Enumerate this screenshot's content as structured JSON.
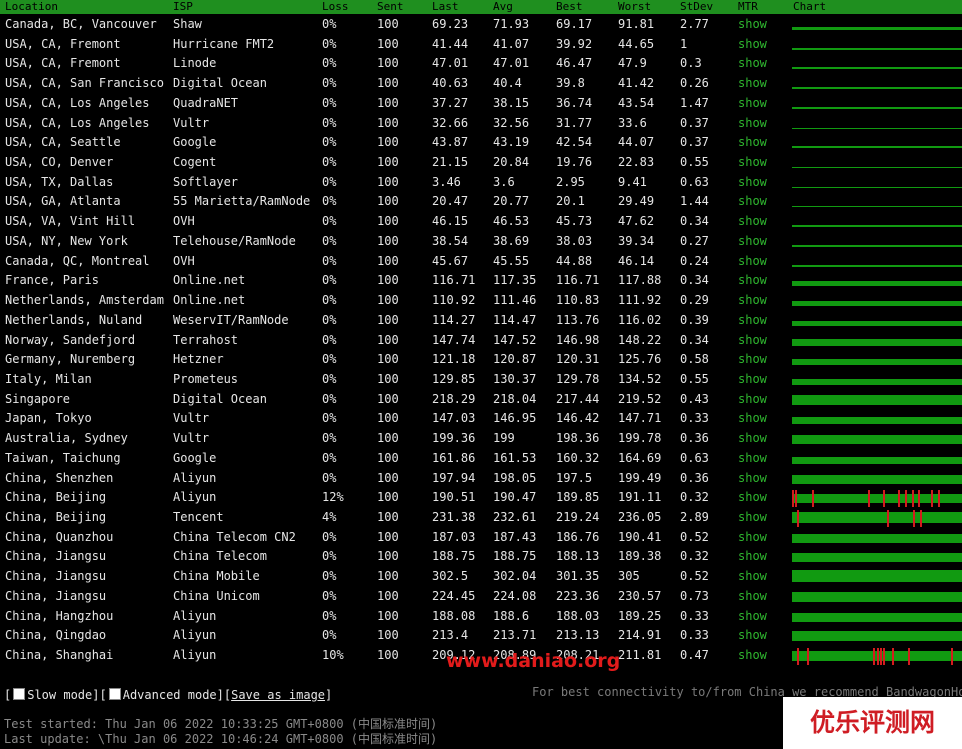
{
  "colors": {
    "header_bg": "#1f8f1f",
    "chart_green": "#119a11",
    "loss_red": "#d41d1d",
    "mtr_link": "#2fb72f"
  },
  "headers": {
    "location": "Location",
    "isp": "ISP",
    "loss": "Loss",
    "sent": "Sent",
    "last": "Last",
    "avg": "Avg",
    "best": "Best",
    "worst": "Worst",
    "stdev": "StDev",
    "mtr": "MTR",
    "chart": "Chart"
  },
  "rows": [
    {
      "location": "Canada, BC, Vancouver",
      "isp": "Shaw",
      "loss": "0%",
      "sent": "100",
      "last": "69.23",
      "avg": "71.93",
      "best": "69.17",
      "worst": "91.81",
      "stdev": "2.77",
      "mtr": "show",
      "chart_fill": 0.28,
      "chart_spikes": []
    },
    {
      "location": "USA, CA, Fremont",
      "isp": "Hurricane FMT2",
      "loss": "0%",
      "sent": "100",
      "last": "41.44",
      "avg": "41.07",
      "best": "39.92",
      "worst": "44.65",
      "stdev": "1",
      "mtr": "show",
      "chart_fill": 0.16,
      "chart_spikes": []
    },
    {
      "location": "USA, CA, Fremont",
      "isp": "Linode",
      "loss": "0%",
      "sent": "100",
      "last": "47.01",
      "avg": "47.01",
      "best": "46.47",
      "worst": "47.9",
      "stdev": "0.3",
      "mtr": "show",
      "chart_fill": 0.18,
      "chart_spikes": []
    },
    {
      "location": "USA, CA, San Francisco",
      "isp": "Digital Ocean",
      "loss": "0%",
      "sent": "100",
      "last": "40.63",
      "avg": "40.4",
      "best": "39.8",
      "worst": "41.42",
      "stdev": "0.26",
      "mtr": "show",
      "chart_fill": 0.15,
      "chart_spikes": []
    },
    {
      "location": "USA, CA, Los Angeles",
      "isp": "QuadraNET",
      "loss": "0%",
      "sent": "100",
      "last": "37.27",
      "avg": "38.15",
      "best": "36.74",
      "worst": "43.54",
      "stdev": "1.47",
      "mtr": "show",
      "chart_fill": 0.15,
      "chart_spikes": []
    },
    {
      "location": "USA, CA, Los Angeles",
      "isp": "Vultr",
      "loss": "0%",
      "sent": "100",
      "last": "32.66",
      "avg": "32.56",
      "best": "31.77",
      "worst": "33.6",
      "stdev": "0.37",
      "mtr": "show",
      "chart_fill": 0.12,
      "chart_spikes": []
    },
    {
      "location": "USA, CA, Seattle",
      "isp": "Google",
      "loss": "0%",
      "sent": "100",
      "last": "43.87",
      "avg": "43.19",
      "best": "42.54",
      "worst": "44.07",
      "stdev": "0.37",
      "mtr": "show",
      "chart_fill": 0.17,
      "chart_spikes": []
    },
    {
      "location": "USA, CO, Denver",
      "isp": "Cogent",
      "loss": "0%",
      "sent": "100",
      "last": "21.15",
      "avg": "20.84",
      "best": "19.76",
      "worst": "22.83",
      "stdev": "0.55",
      "mtr": "show",
      "chart_fill": 0.08,
      "chart_spikes": []
    },
    {
      "location": "USA, TX, Dallas",
      "isp": "Softlayer",
      "loss": "0%",
      "sent": "100",
      "last": "3.46",
      "avg": "3.6",
      "best": "2.95",
      "worst": "9.41",
      "stdev": "0.63",
      "mtr": "show",
      "chart_fill": 0.05,
      "chart_spikes": []
    },
    {
      "location": "USA, GA, Atlanta",
      "isp": "55 Marietta/RamNode",
      "loss": "0%",
      "sent": "100",
      "last": "20.47",
      "avg": "20.77",
      "best": "20.1",
      "worst": "29.49",
      "stdev": "1.44",
      "mtr": "show",
      "chart_fill": 0.08,
      "chart_spikes": []
    },
    {
      "location": "USA, VA, Vint Hill",
      "isp": "OVH",
      "loss": "0%",
      "sent": "100",
      "last": "46.15",
      "avg": "46.53",
      "best": "45.73",
      "worst": "47.62",
      "stdev": "0.34",
      "mtr": "show",
      "chart_fill": 0.18,
      "chart_spikes": []
    },
    {
      "location": "USA, NY, New York",
      "isp": "Telehouse/RamNode",
      "loss": "0%",
      "sent": "100",
      "last": "38.54",
      "avg": "38.69",
      "best": "38.03",
      "worst": "39.34",
      "stdev": "0.27",
      "mtr": "show",
      "chart_fill": 0.15,
      "chart_spikes": []
    },
    {
      "location": "Canada, QC, Montreal",
      "isp": "OVH",
      "loss": "0%",
      "sent": "100",
      "last": "45.67",
      "avg": "45.55",
      "best": "44.88",
      "worst": "46.14",
      "stdev": "0.24",
      "mtr": "show",
      "chart_fill": 0.17,
      "chart_spikes": []
    },
    {
      "location": "France, Paris",
      "isp": "Online.net",
      "loss": "0%",
      "sent": "100",
      "last": "116.71",
      "avg": "117.35",
      "best": "116.71",
      "worst": "117.88",
      "stdev": "0.34",
      "mtr": "show",
      "chart_fill": 0.45,
      "chart_spikes": []
    },
    {
      "location": "Netherlands, Amsterdam",
      "isp": "Online.net",
      "loss": "0%",
      "sent": "100",
      "last": "110.92",
      "avg": "111.46",
      "best": "110.83",
      "worst": "111.92",
      "stdev": "0.29",
      "mtr": "show",
      "chart_fill": 0.43,
      "chart_spikes": []
    },
    {
      "location": "Netherlands, Nuland",
      "isp": "WeservIT/RamNode",
      "loss": "0%",
      "sent": "100",
      "last": "114.27",
      "avg": "114.47",
      "best": "113.76",
      "worst": "116.02",
      "stdev": "0.39",
      "mtr": "show",
      "chart_fill": 0.44,
      "chart_spikes": []
    },
    {
      "location": "Norway, Sandefjord",
      "isp": "Terrahost",
      "loss": "0%",
      "sent": "100",
      "last": "147.74",
      "avg": "147.52",
      "best": "146.98",
      "worst": "148.22",
      "stdev": "0.34",
      "mtr": "show",
      "chart_fill": 0.57,
      "chart_spikes": []
    },
    {
      "location": "Germany, Nuremberg",
      "isp": "Hetzner",
      "loss": "0%",
      "sent": "100",
      "last": "121.18",
      "avg": "120.87",
      "best": "120.31",
      "worst": "125.76",
      "stdev": "0.58",
      "mtr": "show",
      "chart_fill": 0.47,
      "chart_spikes": []
    },
    {
      "location": "Italy, Milan",
      "isp": "Prometeus",
      "loss": "0%",
      "sent": "100",
      "last": "129.85",
      "avg": "130.37",
      "best": "129.78",
      "worst": "134.52",
      "stdev": "0.55",
      "mtr": "show",
      "chart_fill": 0.5,
      "chart_spikes": []
    },
    {
      "location": "Singapore",
      "isp": "Digital Ocean",
      "loss": "0%",
      "sent": "100",
      "last": "218.29",
      "avg": "218.04",
      "best": "217.44",
      "worst": "219.52",
      "stdev": "0.43",
      "mtr": "show",
      "chart_fill": 0.84,
      "chart_spikes": []
    },
    {
      "location": "Japan, Tokyo",
      "isp": "Vultr",
      "loss": "0%",
      "sent": "100",
      "last": "147.03",
      "avg": "146.95",
      "best": "146.42",
      "worst": "147.71",
      "stdev": "0.33",
      "mtr": "show",
      "chart_fill": 0.57,
      "chart_spikes": []
    },
    {
      "location": "Australia, Sydney",
      "isp": "Vultr",
      "loss": "0%",
      "sent": "100",
      "last": "199.36",
      "avg": "199",
      "best": "198.36",
      "worst": "199.78",
      "stdev": "0.36",
      "mtr": "show",
      "chart_fill": 0.77,
      "chart_spikes": []
    },
    {
      "location": "Taiwan, Taichung",
      "isp": "Google",
      "loss": "0%",
      "sent": "100",
      "last": "161.86",
      "avg": "161.53",
      "best": "160.32",
      "worst": "164.69",
      "stdev": "0.63",
      "mtr": "show",
      "chart_fill": 0.62,
      "chart_spikes": []
    },
    {
      "location": "China, Shenzhen",
      "isp": "Aliyun",
      "loss": "0%",
      "sent": "100",
      "last": "197.94",
      "avg": "198.05",
      "best": "197.5",
      "worst": "199.49",
      "stdev": "0.36",
      "mtr": "show",
      "chart_fill": 0.76,
      "chart_spikes": []
    },
    {
      "location": "China, Beijing",
      "isp": "Aliyun",
      "loss": "12%",
      "sent": "100",
      "last": "190.51",
      "avg": "190.47",
      "best": "189.85",
      "worst": "191.11",
      "stdev": "0.32",
      "mtr": "show",
      "chart_fill": 0.73,
      "chart_spikes": [
        0.0,
        0.02,
        0.12,
        0.46,
        0.55,
        0.64,
        0.68,
        0.72,
        0.76,
        0.84,
        0.88
      ]
    },
    {
      "location": "China, Beijing",
      "isp": "Tencent",
      "loss": "4%",
      "sent": "100",
      "last": "231.38",
      "avg": "232.61",
      "best": "219.24",
      "worst": "236.05",
      "stdev": "2.89",
      "mtr": "show",
      "chart_fill": 0.9,
      "chart_spikes": [
        0.03,
        0.57,
        0.73,
        0.77
      ]
    },
    {
      "location": "China, Quanzhou",
      "isp": "China Telecom CN2",
      "loss": "0%",
      "sent": "100",
      "last": "187.03",
      "avg": "187.43",
      "best": "186.76",
      "worst": "190.41",
      "stdev": "0.52",
      "mtr": "show",
      "chart_fill": 0.72,
      "chart_spikes": []
    },
    {
      "location": "China, Jiangsu",
      "isp": "China Telecom",
      "loss": "0%",
      "sent": "100",
      "last": "188.75",
      "avg": "188.75",
      "best": "188.13",
      "worst": "189.38",
      "stdev": "0.32",
      "mtr": "show",
      "chart_fill": 0.73,
      "chart_spikes": []
    },
    {
      "location": "China, Jiangsu",
      "isp": "China Mobile",
      "loss": "0%",
      "sent": "100",
      "last": "302.5",
      "avg": "302.04",
      "best": "301.35",
      "worst": "305",
      "stdev": "0.52",
      "mtr": "show",
      "chart_fill": 1.0,
      "chart_spikes": []
    },
    {
      "location": "China, Jiangsu",
      "isp": "China Unicom",
      "loss": "0%",
      "sent": "100",
      "last": "224.45",
      "avg": "224.08",
      "best": "223.36",
      "worst": "230.57",
      "stdev": "0.73",
      "mtr": "show",
      "chart_fill": 0.87,
      "chart_spikes": []
    },
    {
      "location": "China, Hangzhou",
      "isp": "Aliyun",
      "loss": "0%",
      "sent": "100",
      "last": "188.08",
      "avg": "188.6",
      "best": "188.03",
      "worst": "189.25",
      "stdev": "0.33",
      "mtr": "show",
      "chart_fill": 0.73,
      "chart_spikes": []
    },
    {
      "location": "China, Qingdao",
      "isp": "Aliyun",
      "loss": "0%",
      "sent": "100",
      "last": "213.4",
      "avg": "213.71",
      "best": "213.13",
      "worst": "214.91",
      "stdev": "0.33",
      "mtr": "show",
      "chart_fill": 0.82,
      "chart_spikes": []
    },
    {
      "location": "China, Shanghai",
      "isp": "Aliyun",
      "loss": "10%",
      "sent": "100",
      "last": "209.12",
      "avg": "208.89",
      "best": "208.21",
      "worst": "211.81",
      "stdev": "0.47",
      "mtr": "show",
      "chart_fill": 0.8,
      "chart_spikes": [
        0.03,
        0.09,
        0.49,
        0.51,
        0.53,
        0.55,
        0.6,
        0.7,
        0.96
      ]
    }
  ],
  "controls": {
    "slow_mode": "Slow mode",
    "advanced_mode": "Advanced mode",
    "save_image": "Save as image"
  },
  "recommend_text": "For best connectivity to/from China we recommend BandwagonHo",
  "status": {
    "started": "Test started: Thu Jan 06 2022 10:33:25 GMT+0800 (中国标准时间)",
    "updated": "Last update: \\Thu Jan 06 2022 10:46:24 GMT+0800 (中国标准时间)"
  },
  "watermark": {
    "url": "www.daniao.org",
    "brand": "优乐评测网"
  }
}
